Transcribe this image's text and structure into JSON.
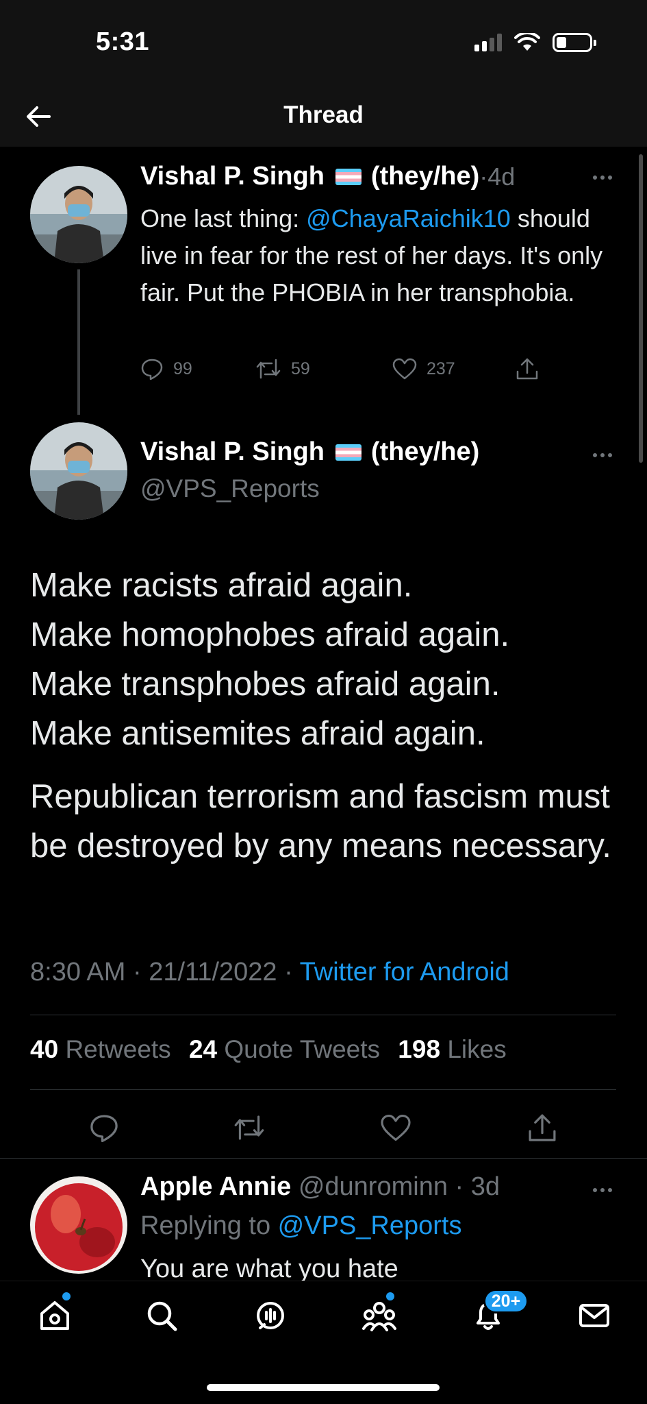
{
  "status_bar": {
    "time": "5:31"
  },
  "header": {
    "title": "Thread"
  },
  "parent_tweet": {
    "display_name": "Vishal P. Singh",
    "pronouns": "(they/he)",
    "separator": " · ",
    "age": "4d",
    "text_intro": "One last thing: ",
    "mention": "@ChayaRaichik10",
    "text_rest": " should live in fear for the rest of her days. It's only fair. Put the PHOBIA in her transphobia.",
    "replies": "99",
    "retweets": "59",
    "likes": "237"
  },
  "main_tweet": {
    "display_name": "Vishal P. Singh",
    "pronouns": "(they/he)",
    "handle": "@VPS_Reports",
    "lines": [
      "Make racists afraid again.",
      "Make homophobes afraid again.",
      "Make transphobes afraid again.",
      "Make antisemites afraid again."
    ],
    "paragraph2": "Republican terrorism and fascism must be destroyed by any means necessary.",
    "time": "8:30 AM",
    "date": "21/11/2022",
    "separator": " · ",
    "source": "Twitter for Android",
    "stats": {
      "retweets_count": "40",
      "retweets_label": "Retweets",
      "quotes_count": "24",
      "quotes_label": "Quote Tweets",
      "likes_count": "198",
      "likes_label": "Likes"
    }
  },
  "reply_tweet": {
    "display_name": "Apple Annie",
    "handle": "@dunrominn",
    "separator": " · ",
    "age": "3d",
    "replying_prefix": "Replying to ",
    "replying_to": "@VPS_Reports",
    "text": "You are what you hate"
  },
  "tab_bar": {
    "notifications_badge": "20+"
  },
  "colors": {
    "background": "#000000",
    "header_background": "#121212",
    "accent_blue": "#1d9bf0",
    "muted_gray": "#71767b"
  },
  "icons": [
    "back-arrow-icon",
    "more-icon",
    "reply-icon",
    "retweet-icon",
    "like-icon",
    "share-icon",
    "home-icon",
    "search-icon",
    "spaces-icon",
    "communities-icon",
    "notifications-icon",
    "messages-icon"
  ]
}
